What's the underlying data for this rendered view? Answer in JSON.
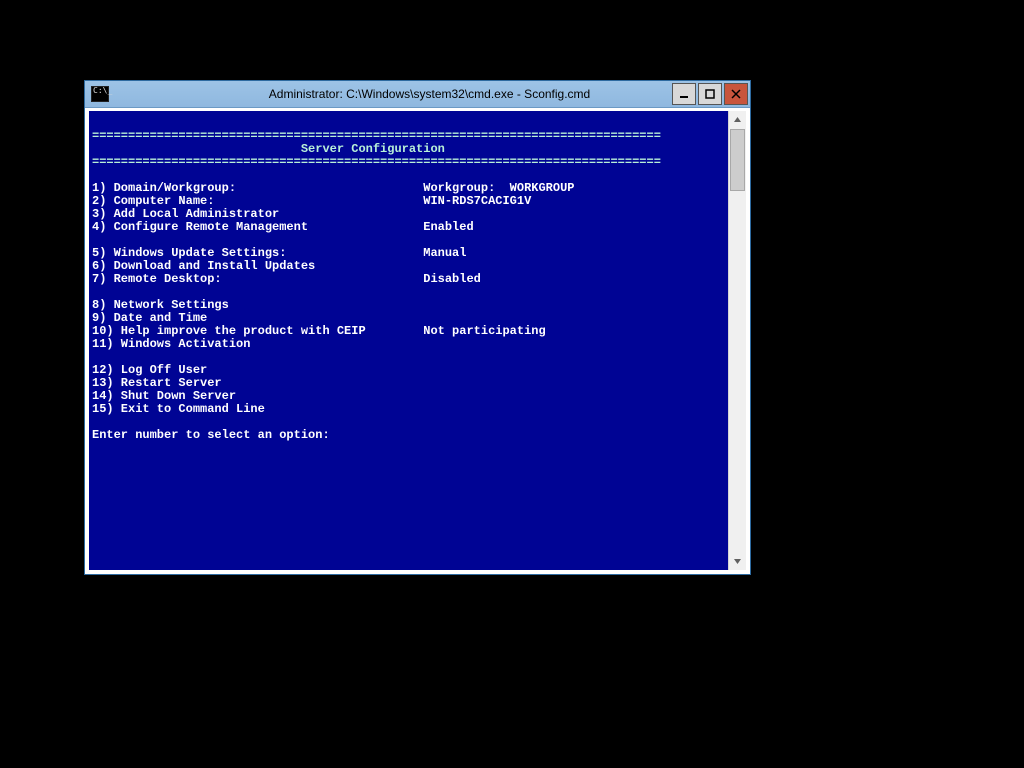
{
  "window": {
    "title": "Administrator: C:\\Windows\\system32\\cmd.exe - Sconfig.cmd"
  },
  "console": {
    "rule": "===============================================================================",
    "header": "                             Server Configuration",
    "value_col": 46,
    "groups": [
      [
        {
          "n": "1",
          "label": "Domain/Workgroup:",
          "value": "Workgroup:  WORKGROUP"
        },
        {
          "n": "2",
          "label": "Computer Name:",
          "value": "WIN-RDS7CACIG1V"
        },
        {
          "n": "3",
          "label": "Add Local Administrator",
          "value": ""
        },
        {
          "n": "4",
          "label": "Configure Remote Management",
          "value": "Enabled"
        }
      ],
      [
        {
          "n": "5",
          "label": "Windows Update Settings:",
          "value": "Manual"
        },
        {
          "n": "6",
          "label": "Download and Install Updates",
          "value": ""
        },
        {
          "n": "7",
          "label": "Remote Desktop:",
          "value": "Disabled"
        }
      ],
      [
        {
          "n": "8",
          "label": "Network Settings",
          "value": ""
        },
        {
          "n": "9",
          "label": "Date and Time",
          "value": ""
        },
        {
          "n": "10",
          "label": "Help improve the product with CEIP",
          "value": "Not participating"
        },
        {
          "n": "11",
          "label": "Windows Activation",
          "value": ""
        }
      ],
      [
        {
          "n": "12",
          "label": "Log Off User",
          "value": ""
        },
        {
          "n": "13",
          "label": "Restart Server",
          "value": ""
        },
        {
          "n": "14",
          "label": "Shut Down Server",
          "value": ""
        },
        {
          "n": "15",
          "label": "Exit to Command Line",
          "value": ""
        }
      ]
    ],
    "prompt": "Enter number to select an option: "
  }
}
